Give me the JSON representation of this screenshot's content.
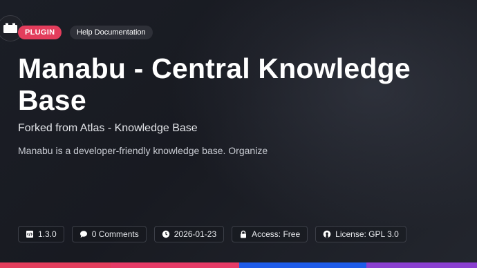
{
  "header": {
    "plugin_badge": "PLUGIN",
    "category_badge": "Help Documentation"
  },
  "main": {
    "title": "Manabu - Central Knowledge Base",
    "subtitle": "Forked from Atlas - Knowledge Base",
    "description": "Manabu is a developer-friendly knowledge base. Organize"
  },
  "meta": {
    "version": "1.3.0",
    "comments": "0 Comments",
    "date": "2026-01-23",
    "access": "Access: Free",
    "license": "License: GPL 3.0"
  },
  "icons": {
    "plugin": "plugin-icon",
    "version": "code-file-icon",
    "comments": "chat-bubble-icon",
    "date": "clock-icon",
    "access": "lock-icon",
    "license": "open-source-icon"
  },
  "colors": {
    "plugin_badge": "#e33d5c",
    "bar_segments": [
      "#e33d5c",
      "#e33d5c",
      "#1e5be8",
      "#8a3fd0"
    ]
  }
}
